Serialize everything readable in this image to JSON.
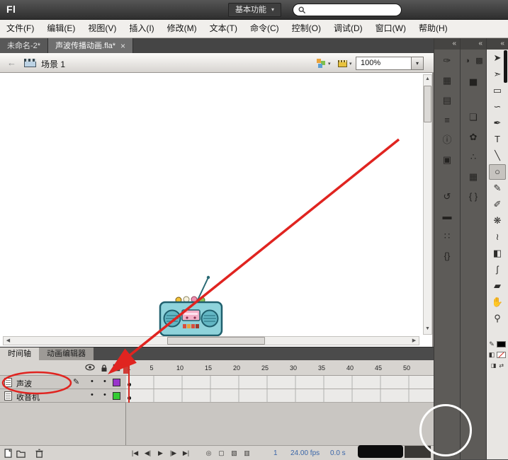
{
  "icons": {
    "caret_down": "▾",
    "collapse": "«",
    "back_arrow": "←",
    "pencil": "✎",
    "dot": "•",
    "close": "×",
    "scroll_up": "▲",
    "scroll_down": "▼",
    "scroll_left": "◀",
    "scroll_right": "▶"
  },
  "titlebar": {
    "logo": "Fl",
    "workspace_button": "基本功能",
    "search_value": ""
  },
  "menubar": {
    "items": [
      "文件(F)",
      "编辑(E)",
      "视图(V)",
      "插入(I)",
      "修改(M)",
      "文本(T)",
      "命令(C)",
      "控制(O)",
      "调试(D)",
      "窗口(W)",
      "帮助(H)"
    ]
  },
  "document_tabs": {
    "tab1": "未命名-2*",
    "tab2": "声波传播动画.fla*"
  },
  "editbar": {
    "scene_label": "场景 1",
    "zoom_value": "100%"
  },
  "dock_a": [
    {
      "name": "color-panel-icon",
      "glyph": "✑"
    },
    {
      "name": "swatches-panel-icon",
      "glyph": "▦"
    },
    {
      "name": "align-panel-icon",
      "glyph": "▤"
    },
    {
      "name": "info-panel-icon",
      "glyph": "≡"
    },
    {
      "name": "properties-panel-icon",
      "glyph": "ⓘ"
    },
    {
      "name": "transform-panel-icon",
      "glyph": "▣"
    },
    {
      "name": "history-panel-icon",
      "glyph": "↺"
    },
    {
      "name": "scene-panel-icon",
      "glyph": "▬"
    },
    {
      "name": "output-panel-icon",
      "glyph": "∷"
    },
    {
      "name": "actions-panel-icon",
      "glyph": "{}"
    }
  ],
  "dock_b": [
    {
      "name": "color-panel-icon",
      "glyph": "◑"
    },
    {
      "name": "swatches-panel-icon",
      "glyph": "▩"
    },
    {
      "name": "align-panel-icon",
      "glyph": "▅"
    },
    {
      "name": "library-panel-icon",
      "glyph": "❏"
    },
    {
      "name": "motion-presets-panel-icon",
      "glyph": "✿"
    },
    {
      "name": "project-panel-icon",
      "glyph": "∴"
    },
    {
      "name": "components-panel-icon",
      "glyph": "▦"
    },
    {
      "name": "code-snippets-panel-icon",
      "glyph": "{ }"
    }
  ],
  "tools": [
    {
      "name": "selection-tool",
      "glyph": "➤"
    },
    {
      "name": "subselection-tool",
      "glyph": "➣"
    },
    {
      "name": "free-transform-tool",
      "glyph": "▭"
    },
    {
      "name": "lasso-tool",
      "glyph": "∽"
    },
    {
      "name": "pen-tool",
      "glyph": "✒"
    },
    {
      "name": "text-tool",
      "glyph": "T"
    },
    {
      "name": "line-tool",
      "glyph": "╲"
    },
    {
      "name": "oval-tool",
      "glyph": "○"
    },
    {
      "name": "pencil-tool",
      "glyph": "✎"
    },
    {
      "name": "brush-tool",
      "glyph": "✐"
    },
    {
      "name": "deco-tool",
      "glyph": "❋"
    },
    {
      "name": "bone-tool",
      "glyph": "≀"
    },
    {
      "name": "paint-bucket-tool",
      "glyph": "◧"
    },
    {
      "name": "eyedropper-tool",
      "glyph": "ʃ"
    },
    {
      "name": "eraser-tool",
      "glyph": "▰"
    },
    {
      "name": "hand-tool",
      "glyph": "✋"
    },
    {
      "name": "zoom-tool",
      "glyph": "⚲"
    }
  ],
  "toolbar_colors": {
    "stroke_color": "#000000",
    "fill_color": "#ffffff"
  },
  "timeline": {
    "tab_timeline": "时间轴",
    "tab_motion_editor": "动画编辑器",
    "ruler": [
      "1",
      "5",
      "10",
      "15",
      "20",
      "25",
      "30",
      "35",
      "40",
      "45",
      "50"
    ],
    "layers": [
      {
        "name": "声波",
        "outline_color": "#9933cc"
      },
      {
        "name": "收音机",
        "outline_color": "#33cc33"
      }
    ],
    "playback": [
      {
        "name": "go-to-first-frame-button",
        "glyph": "|◀"
      },
      {
        "name": "step-back-button",
        "glyph": "◀|"
      },
      {
        "name": "play-button",
        "glyph": "▶"
      },
      {
        "name": "step-forward-button",
        "glyph": "|▶"
      },
      {
        "name": "go-to-last-frame-button",
        "glyph": "▶|"
      }
    ],
    "onion": [
      {
        "name": "center-frame-button",
        "glyph": "◎"
      },
      {
        "name": "onion-skin-button",
        "glyph": "▢"
      },
      {
        "name": "onion-skin-outlines-button",
        "glyph": "▧"
      },
      {
        "name": "edit-multiple-frames-button",
        "glyph": "▥"
      }
    ],
    "status": {
      "current_frame": "1",
      "frame_rate": "24.00 fps",
      "elapsed_time": "0.0 s"
    }
  }
}
